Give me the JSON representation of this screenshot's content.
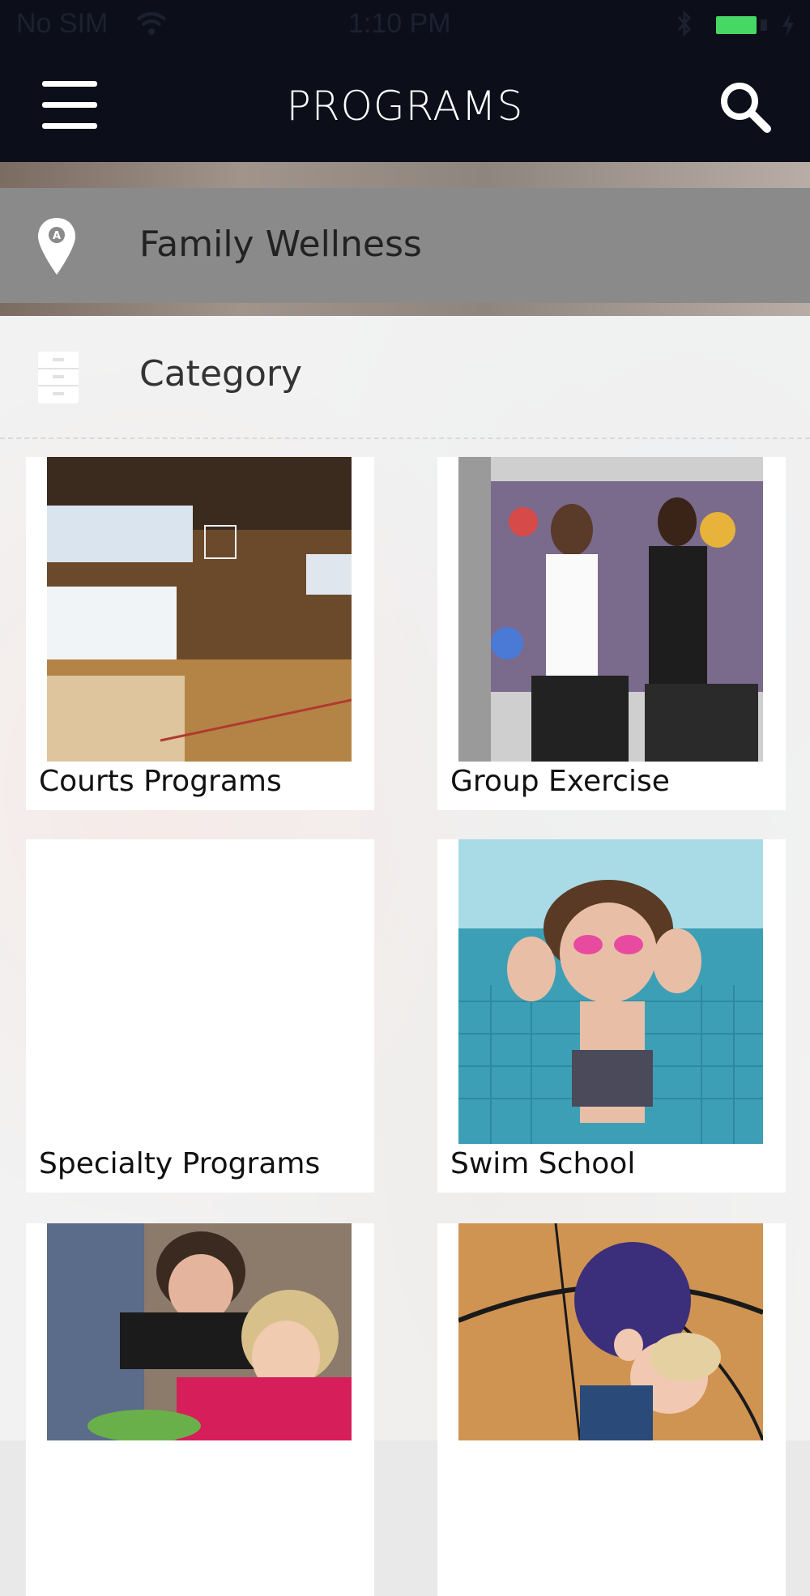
{
  "status_bar": {
    "carrier": "No SIM",
    "time": "1:10 PM",
    "battery_color": "#47d764"
  },
  "header": {
    "title": "PROGRAMS",
    "menu_icon": "hamburger-menu-icon",
    "search_icon": "search-icon"
  },
  "location": {
    "label": "Family Wellness",
    "icon": "map-pin-icon"
  },
  "category": {
    "label": "Category",
    "icon": "file-cabinet-icon"
  },
  "programs": [
    {
      "label": "Courts Programs",
      "image": "gymnasium-court-image"
    },
    {
      "label": "Group Exercise",
      "image": "spin-class-image"
    },
    {
      "label": "Specialty Programs",
      "image": ""
    },
    {
      "label": "Swim School",
      "image": "child-swimming-image"
    },
    {
      "label": "",
      "image": "children-crafts-image"
    },
    {
      "label": "",
      "image": "toddler-ball-image"
    }
  ]
}
